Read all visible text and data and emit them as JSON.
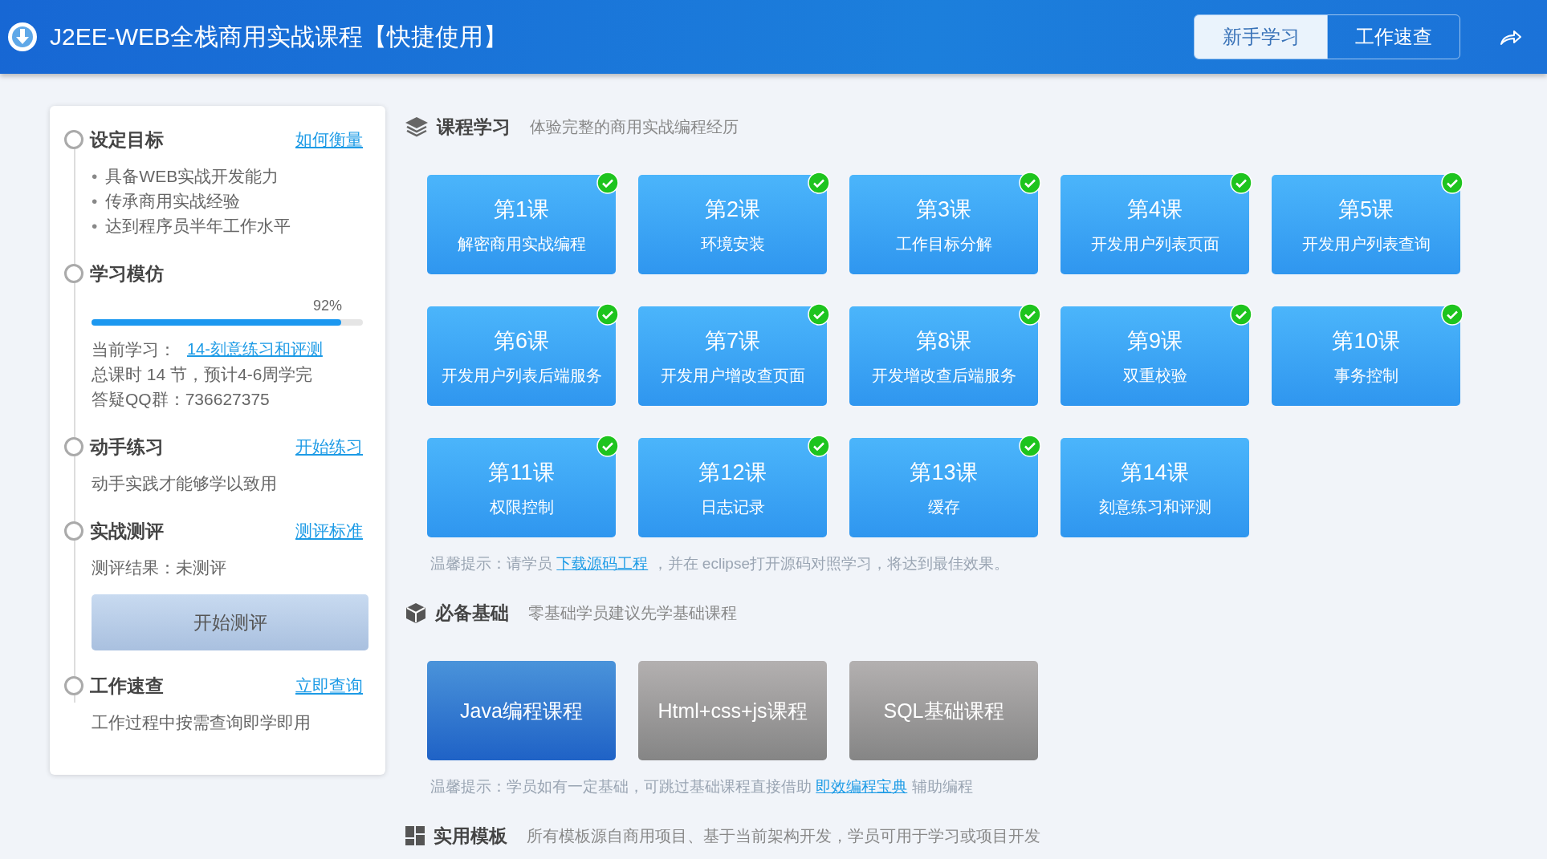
{
  "header": {
    "title": "J2EE-WEB全栈商用实战课程【快捷使用】",
    "tabs": [
      {
        "label": "新手学习",
        "selected": true
      },
      {
        "label": "工作速查",
        "selected": false
      }
    ]
  },
  "sidebar": {
    "steps": [
      {
        "kind": "bullets",
        "title": "设定目标",
        "link": "如何衡量",
        "marker": "•",
        "items": [
          "具备WEB实战开发能力",
          "传承商用实战经验",
          "达到程序员半年工作水平"
        ]
      },
      {
        "kind": "progress",
        "title": "学习模仿",
        "percent": "92%",
        "level": 0.92,
        "current_label": "当前学习：",
        "current_link": "14-刻意练习和评测",
        "lines": [
          "总课时 14 节，预计4-6周学完",
          "答疑QQ群：736627375"
        ]
      },
      {
        "kind": "text",
        "title": "动手练习",
        "link": "开始练习",
        "lines": [
          "动手实践才能够学以致用"
        ]
      },
      {
        "kind": "button",
        "title": "实战测评",
        "link": "测评标准",
        "lines": [
          "测评结果：未测评"
        ],
        "button": "开始测评"
      },
      {
        "kind": "text",
        "title": "工作速查",
        "link": "立即查询",
        "lines": [
          "工作过程中按需查询即学即用"
        ]
      }
    ]
  },
  "sections": [
    {
      "kind": "lessons",
      "title": "课程学习",
      "subtitle": "体验完整的商用实战编程经历",
      "lessons": [
        {
          "title": "第1课",
          "name": "解密商用实战编程",
          "done": true
        },
        {
          "title": "第2课",
          "name": "环境安装",
          "done": true
        },
        {
          "title": "第3课",
          "name": "工作目标分解",
          "done": true
        },
        {
          "title": "第4课",
          "name": "开发用户列表页面",
          "done": true
        },
        {
          "title": "第5课",
          "name": "开发用户列表查询",
          "done": true
        },
        {
          "title": "第6课",
          "name": "开发用户列表后端服务",
          "done": true
        },
        {
          "title": "第7课",
          "name": "开发用户增改查页面",
          "done": true
        },
        {
          "title": "第8课",
          "name": "开发增改查后端服务",
          "done": true
        },
        {
          "title": "第9课",
          "name": "双重校验",
          "done": true
        },
        {
          "title": "第10课",
          "name": "事务控制",
          "done": true
        },
        {
          "title": "第11课",
          "name": "权限控制",
          "done": true
        },
        {
          "title": "第12课",
          "name": "日志记录",
          "done": true
        },
        {
          "title": "第13课",
          "name": "缓存",
          "done": true
        },
        {
          "title": "第14课",
          "name": "刻意练习和评测",
          "done": false
        }
      ],
      "tip": {
        "before": "温馨提示：请学员 ",
        "link": "下载源码工程",
        "after": " ，并在 eclipse打开源码对照学习，将达到最佳效果。"
      }
    },
    {
      "kind": "basics",
      "title": "必备基础",
      "subtitle": "零基础学员建议先学基础课程",
      "courses": [
        {
          "label": "Java编程课程",
          "kind": "blue"
        },
        {
          "label": "Html+css+js课程",
          "kind": "gray"
        },
        {
          "label": "SQL基础课程",
          "kind": "gray"
        }
      ],
      "tip": {
        "before": "温馨提示：学员如有一定基础，可跳过基础课程直接借助 ",
        "link": "即效编程宝典",
        "after": " 辅助编程"
      }
    },
    {
      "kind": "templates",
      "title": "实用模板",
      "subtitle": "所有模板源自商用项目、基于当前架构开发，学员可用于学习或项目开发"
    }
  ]
}
